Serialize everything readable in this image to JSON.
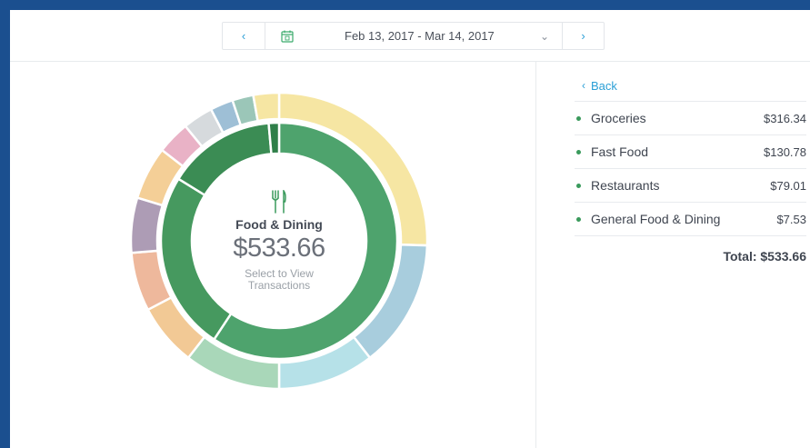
{
  "date_picker": {
    "prev_icon": "chevron-left-icon",
    "calendar_icon": "calendar-icon",
    "range_label": "Feb 13, 2017 - Mar 14, 2017",
    "dropdown_icon": "chevron-down-icon",
    "next_icon": "chevron-right-icon"
  },
  "center": {
    "icon": "fork-knife-icon",
    "title": "Food & Dining",
    "amount": "$533.66",
    "hint_line1": "Select to View",
    "hint_line2": "Transactions"
  },
  "breakdown": {
    "back_label": "Back",
    "items": [
      {
        "name": "Groceries",
        "amount": "$316.34"
      },
      {
        "name": "Fast Food",
        "amount": "$130.78"
      },
      {
        "name": "Restaurants",
        "amount": "$79.01"
      },
      {
        "name": "General Food & Dining",
        "amount": "$7.53"
      }
    ],
    "total_label": "Total: $533.66"
  },
  "colors": {
    "accent_blue": "#2b9fd6",
    "food_green": "#3a9a5c",
    "frame_border": "#1b4f8f"
  },
  "chart_data": {
    "type": "pie",
    "style": "nested donut",
    "inner_ring": {
      "label": "Food & Dining",
      "segments": [
        {
          "value": 316.34,
          "color": "#4ea36d"
        },
        {
          "value": 130.78,
          "color": "#46995f"
        },
        {
          "value": 79.01,
          "color": "#3b8c54"
        },
        {
          "value": 7.53,
          "color": "#2f7f49"
        }
      ]
    },
    "outer_ring": {
      "segments": [
        {
          "value": 25.5,
          "color": "#f6e6a3"
        },
        {
          "value": 14.0,
          "color": "#a8cddd"
        },
        {
          "value": 10.5,
          "color": "#b6e1e8"
        },
        {
          "value": 10.5,
          "color": "#a9d7b9"
        },
        {
          "value": 6.8,
          "color": "#f2c995"
        },
        {
          "value": 6.4,
          "color": "#eeb89c"
        },
        {
          "value": 6.0,
          "color": "#ad9cb5"
        },
        {
          "value": 5.8,
          "color": "#f4cf97"
        },
        {
          "value": 3.6,
          "color": "#e9b2c6"
        },
        {
          "value": 3.3,
          "color": "#d6dadd"
        },
        {
          "value": 2.5,
          "color": "#9ebfd6"
        },
        {
          "value": 2.3,
          "color": "#9bc6b8"
        },
        {
          "value": 2.8,
          "color": "#f6e6a3"
        }
      ]
    }
  }
}
